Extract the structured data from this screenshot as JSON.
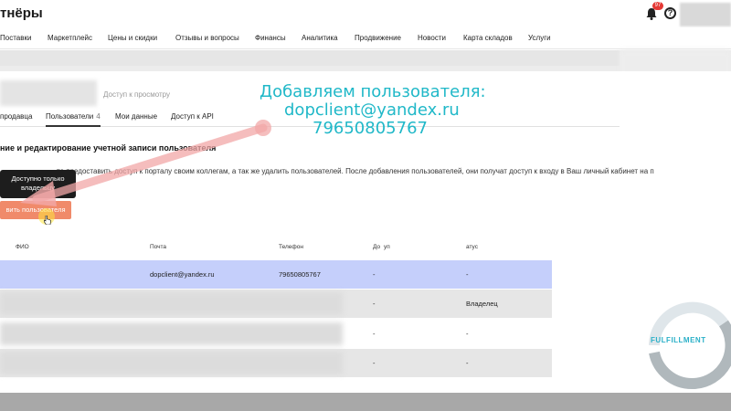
{
  "header": {
    "logo_text": "тнёры",
    "notification_count": "97",
    "help_symbol": "?"
  },
  "nav": {
    "items": [
      "Поставки",
      "Маркетплейс",
      "Цены и скидки",
      "Отзывы и вопросы",
      "Финансы",
      "Аналитика",
      "Продвижение",
      "Новости",
      "Карта складов",
      "Услуги"
    ]
  },
  "company": {
    "access_label": "Доступ к просмотру"
  },
  "tabs": [
    {
      "label": "продавца"
    },
    {
      "label": "Пользователи",
      "count": "4"
    },
    {
      "label": "Мои данные"
    },
    {
      "label": "Доступ к API"
    }
  ],
  "section": {
    "title": "ние и редактирование учетной записи пользователя",
    "description": "те предоставить доступ к порталу своим коллегам, а так же удалить пользователей. После добавления пользователей, они получат доступ к входу в Ваш личный кабинет на п"
  },
  "tooltip": {
    "line1": "Доступно только",
    "line2": "владельцу"
  },
  "add_button": {
    "label": "вить пользователя"
  },
  "table": {
    "headers": {
      "name": "ФИО",
      "email": "Почта",
      "phone": "Телефон",
      "access": "До",
      "access_tail": "уп",
      "status": "атус"
    },
    "rows": [
      {
        "email": "dopclient@yandex.ru",
        "phone": "79650805767",
        "access": "-",
        "status": "-"
      },
      {
        "email": "",
        "phone": "",
        "access": "-",
        "status": "Владелец"
      },
      {
        "email": "",
        "phone": "",
        "access": "-",
        "status": "-"
      },
      {
        "email": "",
        "phone": "",
        "access": "-",
        "status": "-"
      }
    ]
  },
  "overlay": {
    "line1": "Добавляем пользователя:",
    "line2": "dopclient@yandex.ru",
    "line3": "79650805767"
  },
  "watermark": {
    "text": "FULFILLMENT"
  },
  "colors": {
    "overlay_text": "#20b8c8",
    "arrow": "#f2a8a8",
    "button": "#f08a6a",
    "row_highlight": "#c5cffb"
  }
}
